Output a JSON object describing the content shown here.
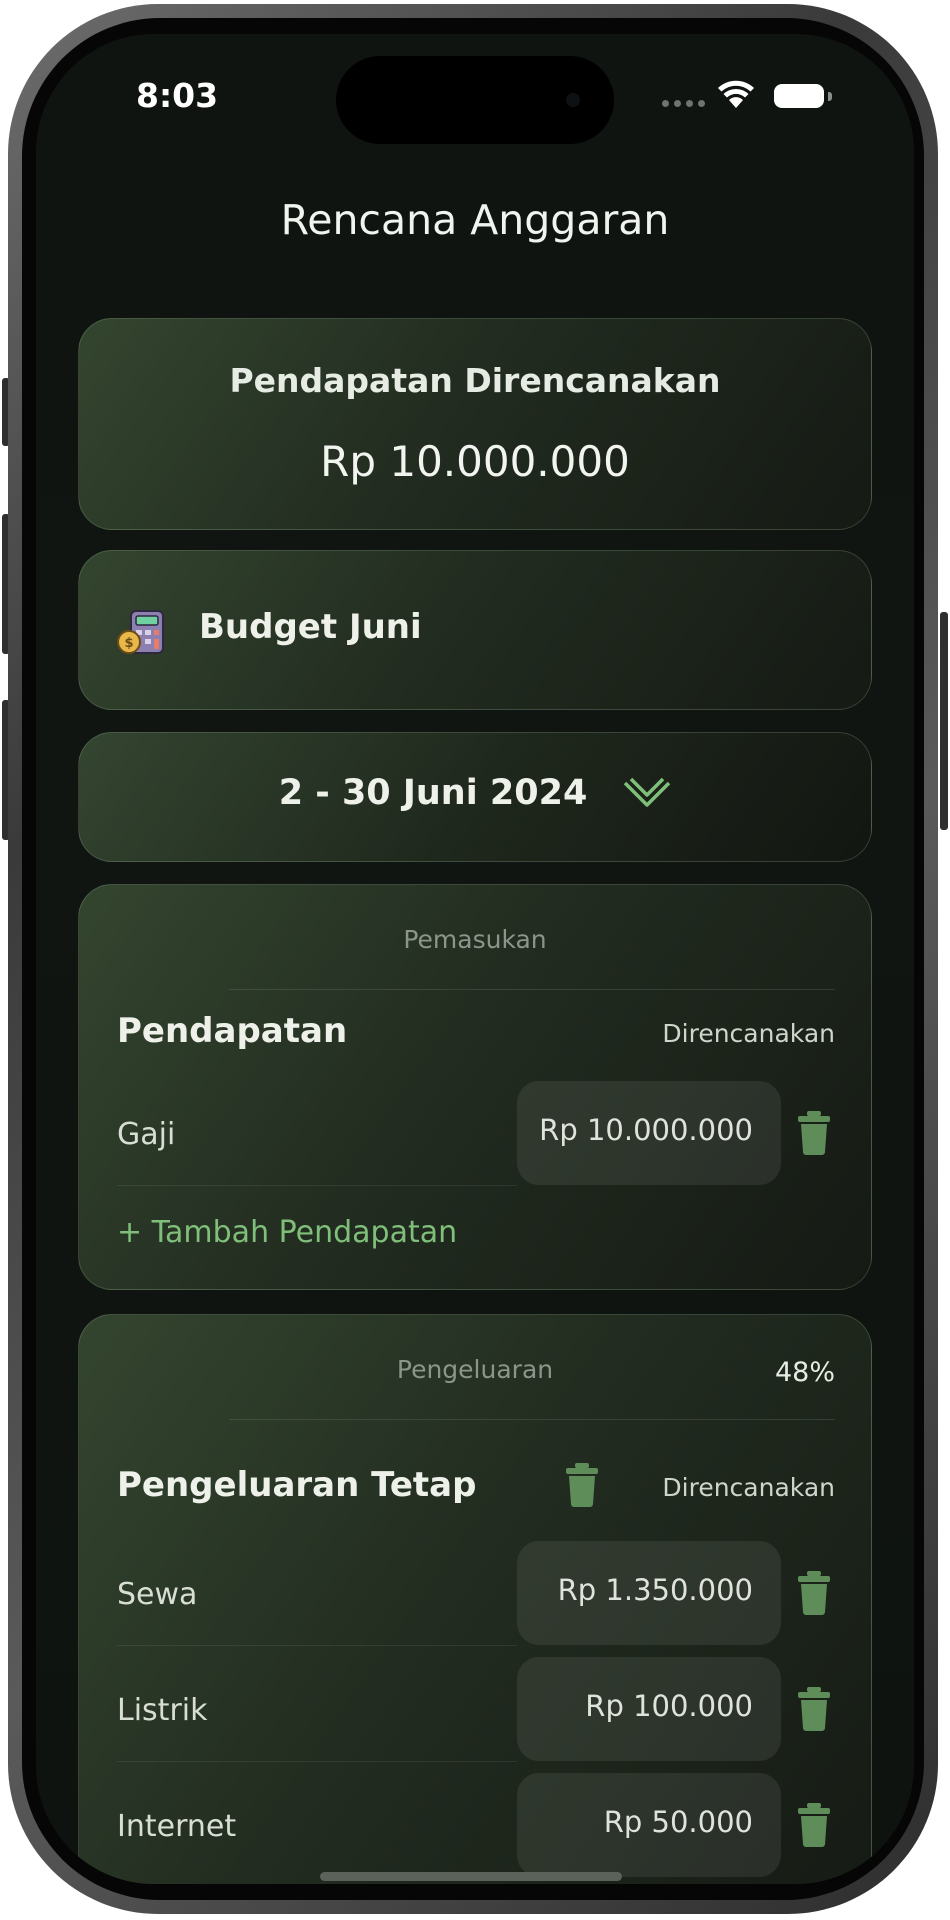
{
  "status": {
    "time": "8:03"
  },
  "header": {
    "title": "Rencana Anggaran"
  },
  "income_summary": {
    "label": "Pendapatan Direncanakan",
    "value": "Rp 10.000.000"
  },
  "budget": {
    "name": "Budget Juni",
    "icon": "calculator-coins-icon"
  },
  "period": {
    "label": "2 - 30 Juni 2024",
    "icon": "chevron-down-icon"
  },
  "income_section": {
    "section_label": "Pemasukan",
    "group_title": "Pendapatan",
    "planned_label": "Direncanakan",
    "rows": [
      {
        "label": "Gaji",
        "amount": "Rp 10.000.000"
      }
    ],
    "add_label": "+ Tambah Pendapatan"
  },
  "expense_section": {
    "section_label": "Pengeluaran",
    "percent": "48%",
    "group_title": "Pengeluaran Tetap",
    "planned_label": "Direncanakan",
    "rows": [
      {
        "label": "Sewa",
        "amount": "Rp 1.350.000"
      },
      {
        "label": "Listrik",
        "amount": "Rp 100.000"
      },
      {
        "label": "Internet",
        "amount": "Rp 50.000"
      }
    ]
  },
  "colors": {
    "accent": "#7fbf7a",
    "trash": "#5f8d5a",
    "background": "#0f1410"
  }
}
